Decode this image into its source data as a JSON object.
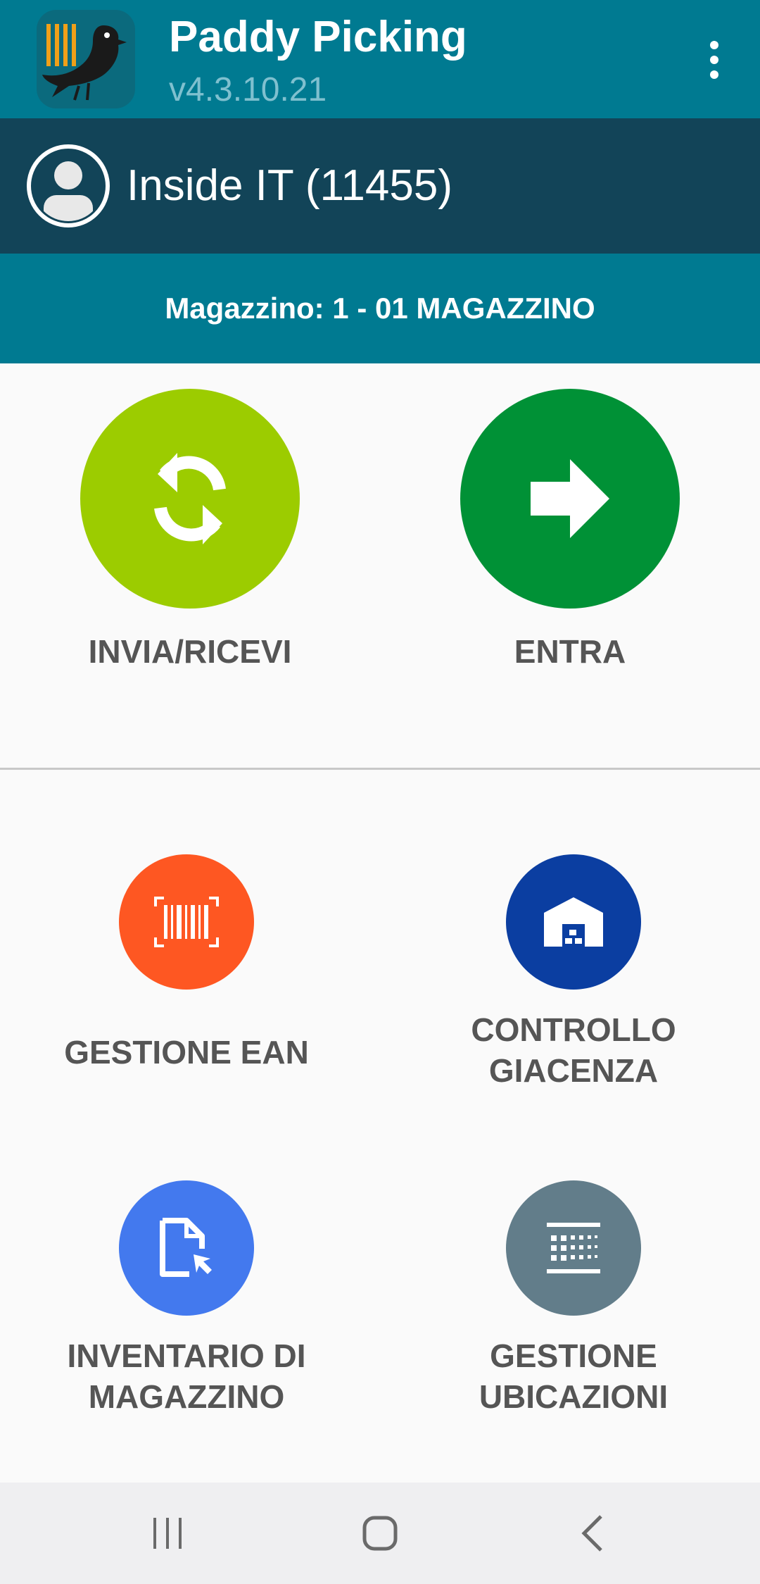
{
  "app": {
    "title": "Paddy Picking",
    "version": "v4.3.10.21",
    "brand_color": "#007a91",
    "user_bar_color": "#124458"
  },
  "user": {
    "name": "Inside IT (11455)"
  },
  "warehouse": {
    "label": "Magazzino: 1 - 01 MAGAZZINO"
  },
  "primary_actions": [
    {
      "label": "INVIA/RICEVI",
      "icon": "sync-icon",
      "color": "#9ccc00"
    },
    {
      "label": "ENTRA",
      "icon": "arrow-right-icon",
      "color": "#009136"
    }
  ],
  "secondary_actions": [
    {
      "label": "GESTIONE EAN",
      "icon": "barcode-icon",
      "color": "#fe5722"
    },
    {
      "label": "CONTROLLO\nGIACENZA",
      "icon": "warehouse-icon",
      "color": "#0b3ea1"
    },
    {
      "label": "INVENTARIO DI\nMAGAZZINO",
      "icon": "document-cursor-icon",
      "color": "#4379ee"
    },
    {
      "label": "GESTIONE\nUBICAZIONI",
      "icon": "shelf-grid-icon",
      "color": "#627d8a"
    }
  ],
  "nav": {
    "recents": "recents-icon",
    "home": "home-icon",
    "back": "back-icon"
  }
}
